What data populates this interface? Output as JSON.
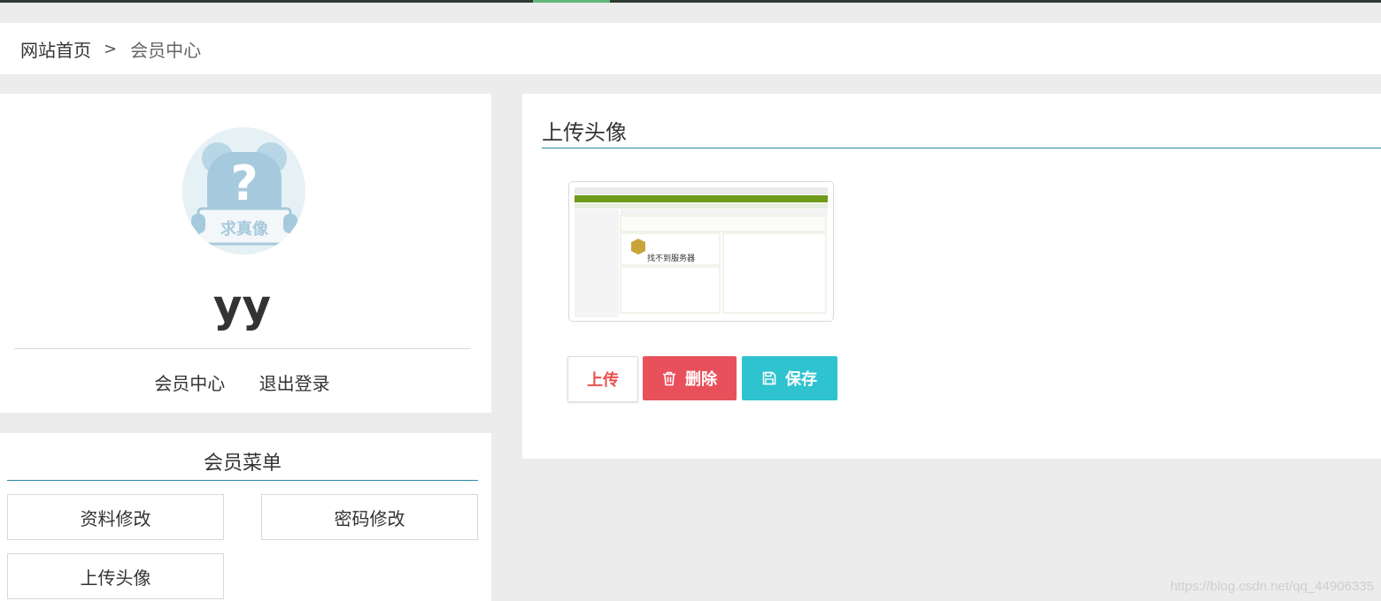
{
  "breadcrumb": {
    "home": "网站首页",
    "separator": ">",
    "current": "会员中心"
  },
  "profile": {
    "avatar_text": "?",
    "avatar_sign": "求真像",
    "username": "yy",
    "links": {
      "member_center": "会员中心",
      "logout": "退出登录"
    }
  },
  "menu": {
    "title": "会员菜单",
    "items": [
      "资料修改",
      "密码修改",
      "上传头像"
    ]
  },
  "upload": {
    "title": "上传头像",
    "preview_text": "找不到服务器",
    "buttons": {
      "upload": "上传",
      "delete": "删除",
      "save": "保存"
    }
  },
  "watermark": "https://blog.csdn.net/qq_44906335",
  "colors": {
    "accent_line": "#2b8ba8",
    "delete_button": "#e8515c",
    "save_button": "#2ec3cf",
    "upload_text": "#e8514f"
  }
}
